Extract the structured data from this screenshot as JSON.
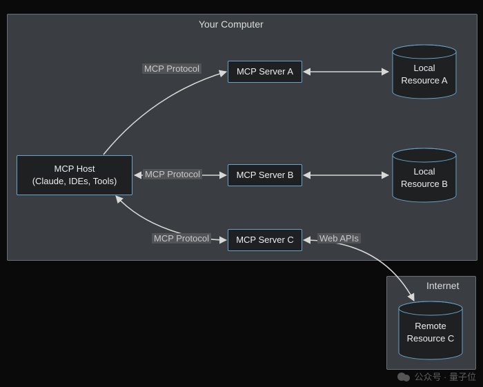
{
  "diagram": {
    "containers": {
      "computer": {
        "label": "Your Computer"
      },
      "internet": {
        "label": "Internet"
      }
    },
    "host": {
      "line1": "MCP Host",
      "line2": "(Claude, IDEs, Tools)"
    },
    "servers": {
      "a": {
        "label": "MCP Server A"
      },
      "b": {
        "label": "MCP Server B"
      },
      "c": {
        "label": "MCP Server C"
      }
    },
    "resources": {
      "a": {
        "line1": "Local",
        "line2": "Resource A"
      },
      "b": {
        "line1": "Local",
        "line2": "Resource B"
      },
      "c": {
        "line1": "Remote",
        "line2": "Resource C"
      }
    },
    "edges": {
      "protocol_a": "MCP Protocol",
      "protocol_b": "MCP Protocol",
      "protocol_c": "MCP Protocol",
      "web_apis": "Web APIs"
    }
  },
  "watermark": {
    "text": "公众号 · 量子位"
  }
}
